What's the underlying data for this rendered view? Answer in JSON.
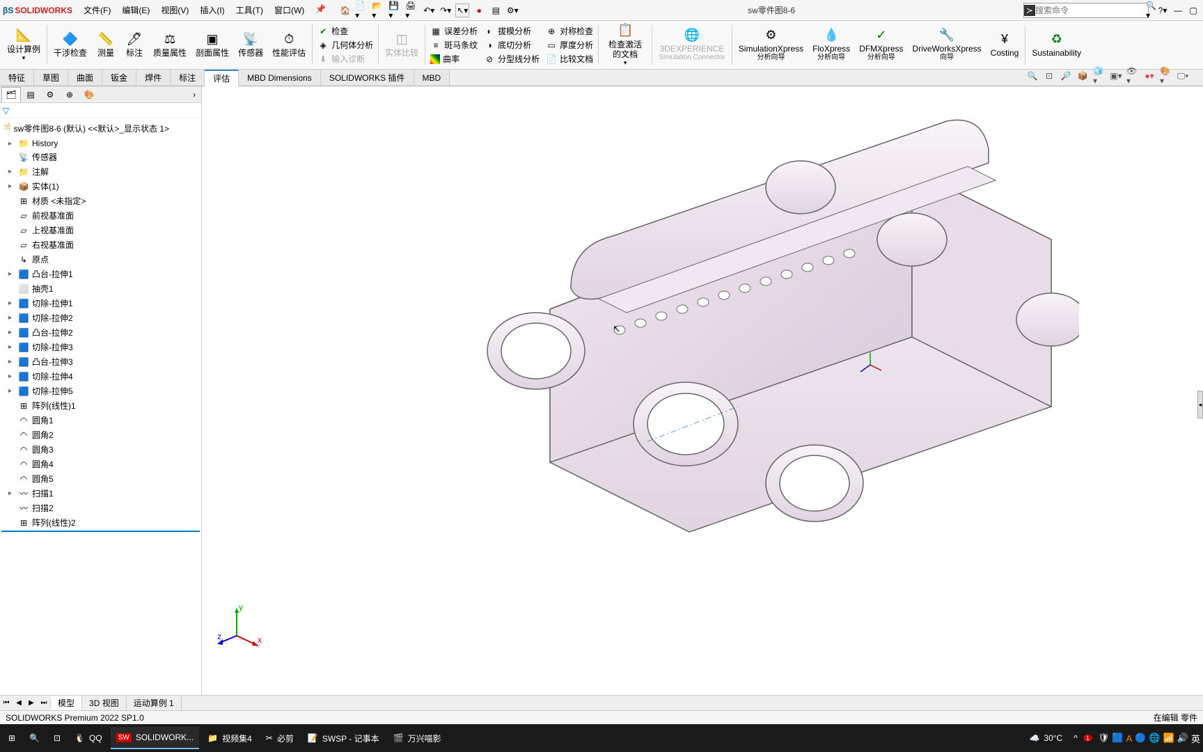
{
  "logo": {
    "brand": "SOLIDWORKS"
  },
  "menu": [
    "文件(F)",
    "编辑(E)",
    "视图(V)",
    "插入(I)",
    "工具(T)",
    "窗口(W)"
  ],
  "doc_title": "sw零件图8-6",
  "search": {
    "placeholder": "搜索命令"
  },
  "ribbon": {
    "big": [
      {
        "label": "设计算例",
        "icon": "📐"
      },
      {
        "label": "干涉检查",
        "icon": "🔷"
      },
      {
        "label": "测量",
        "icon": "📏"
      },
      {
        "label": "标注",
        "icon": "🖊"
      },
      {
        "label": "质量属性",
        "icon": "⚖"
      },
      {
        "label": "剖面属性",
        "icon": "▣"
      },
      {
        "label": "传感器",
        "icon": "📡"
      },
      {
        "label": "性能评估",
        "icon": "⏱"
      }
    ],
    "group1": [
      {
        "label": "检查",
        "icon": "✔"
      },
      {
        "label": "几何体分析",
        "icon": "◈"
      },
      {
        "label": "输入诊断",
        "icon": "⬇",
        "disabled": true
      }
    ],
    "solid_compare": {
      "label": "实体比较",
      "disabled": true
    },
    "group2": [
      {
        "label": "误差分析",
        "icon": "▦"
      },
      {
        "label": "斑马条纹",
        "icon": "≡"
      },
      {
        "label": "曲率",
        "icon": "▨"
      }
    ],
    "group3": [
      {
        "label": "拔模分析",
        "icon": "◐"
      },
      {
        "label": "底切分析",
        "icon": "◑"
      },
      {
        "label": "分型线分析",
        "icon": "⊘"
      }
    ],
    "group4": [
      {
        "label": "对称检查",
        "icon": "⊕"
      },
      {
        "label": "厚度分析",
        "icon": "▭"
      },
      {
        "label": "比较文档",
        "icon": "📄"
      }
    ],
    "activate": "检查激活的文档",
    "big2": [
      {
        "label": "3DEXPERIENCE",
        "sub": "Simulation Connector",
        "icon": "🌐",
        "disabled": true
      },
      {
        "label": "SimulationXpress",
        "sub": "分析向导",
        "icon": "⚙"
      },
      {
        "label": "FloXpress",
        "sub": "分析向导",
        "icon": "💧"
      },
      {
        "label": "DFMXpress",
        "sub": "分析向导",
        "icon": "✓"
      },
      {
        "label": "DriveWorksXpress",
        "sub": "向导",
        "icon": "🔧"
      },
      {
        "label": "Costing",
        "icon": "¥"
      },
      {
        "label": "Sustainability",
        "icon": "♻"
      }
    ]
  },
  "cmd_tabs": [
    "特征",
    "草图",
    "曲面",
    "钣金",
    "焊件",
    "标注",
    "评估",
    "MBD Dimensions",
    "SOLIDWORKS 插件",
    "MBD"
  ],
  "cmd_tabs_active": "评估",
  "tree": {
    "root": "sw零件图8-6 (默认) <<默认>_显示状态 1>",
    "items": [
      {
        "label": "History",
        "icon": "📁",
        "exp": "▸"
      },
      {
        "label": "传感器",
        "icon": "📡",
        "exp": ""
      },
      {
        "label": "注解",
        "icon": "📁",
        "exp": "▸"
      },
      {
        "label": "实体(1)",
        "icon": "📦",
        "exp": "▸"
      },
      {
        "label": "材质 <未指定>",
        "icon": "⊞",
        "exp": ""
      },
      {
        "label": "前视基准面",
        "icon": "▱",
        "exp": ""
      },
      {
        "label": "上视基准面",
        "icon": "▱",
        "exp": ""
      },
      {
        "label": "右视基准面",
        "icon": "▱",
        "exp": ""
      },
      {
        "label": "原点",
        "icon": "↳",
        "exp": ""
      },
      {
        "label": "凸台-拉伸1",
        "icon": "🟦",
        "exp": "▸"
      },
      {
        "label": "抽壳1",
        "icon": "⬜",
        "exp": ""
      },
      {
        "label": "切除-拉伸1",
        "icon": "🟦",
        "exp": "▸"
      },
      {
        "label": "切除-拉伸2",
        "icon": "🟦",
        "exp": "▸"
      },
      {
        "label": "凸台-拉伸2",
        "icon": "🟦",
        "exp": "▸"
      },
      {
        "label": "切除-拉伸3",
        "icon": "🟦",
        "exp": "▸"
      },
      {
        "label": "凸台-拉伸3",
        "icon": "🟦",
        "exp": "▸"
      },
      {
        "label": "切除-拉伸4",
        "icon": "🟦",
        "exp": "▸"
      },
      {
        "label": "切除-拉伸5",
        "icon": "🟦",
        "exp": "▸"
      },
      {
        "label": "阵列(线性)1",
        "icon": "⊞",
        "exp": ""
      },
      {
        "label": "圆角1",
        "icon": "◠",
        "exp": ""
      },
      {
        "label": "圆角2",
        "icon": "◠",
        "exp": ""
      },
      {
        "label": "圆角3",
        "icon": "◠",
        "exp": ""
      },
      {
        "label": "圆角4",
        "icon": "◠",
        "exp": ""
      },
      {
        "label": "圆角5",
        "icon": "◠",
        "exp": ""
      },
      {
        "label": "扫描1",
        "icon": "〰",
        "exp": "▸"
      },
      {
        "label": "扫描2",
        "icon": "〰",
        "exp": ""
      },
      {
        "label": "阵列(线性)2",
        "icon": "⊞",
        "exp": ""
      }
    ]
  },
  "bottom_tabs": [
    "模型",
    "3D 视图",
    "运动算例 1"
  ],
  "bottom_tabs_active": "模型",
  "status": {
    "left": "SOLIDWORKS Premium 2022 SP1.0",
    "right": "在编辑 零件"
  },
  "taskbar": {
    "items": [
      {
        "label": "QQ",
        "icon": "🐧"
      },
      {
        "label": "SOLIDWORK...",
        "icon": "SW",
        "active": true
      },
      {
        "label": "视频集4",
        "icon": "📁"
      },
      {
        "label": "必剪",
        "icon": "✂"
      },
      {
        "label": "SWSP - 记事本",
        "icon": "📝"
      },
      {
        "label": "万兴喵影",
        "icon": "🎬"
      }
    ],
    "weather_temp": "30°C",
    "weather_label": "",
    "tray_count": "1"
  }
}
